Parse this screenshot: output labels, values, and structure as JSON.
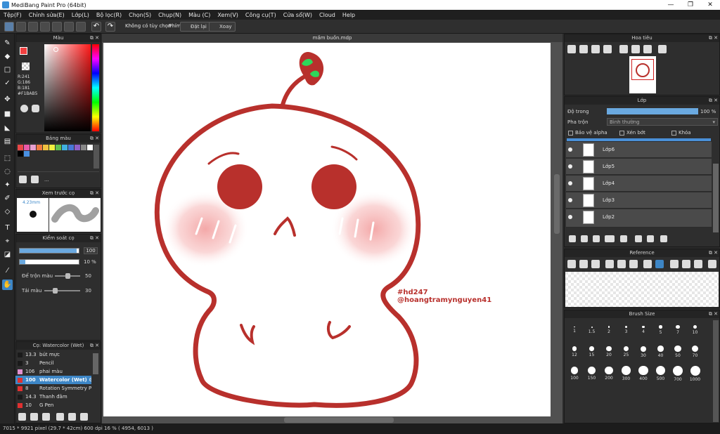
{
  "window": {
    "title": "MediBang Paint Pro (64bit)"
  },
  "menu": [
    "Tệp(F)",
    "Chỉnh sửa(E)",
    "Lớp(L)",
    "Bộ lọc(R)",
    "Chọn(S)",
    "Chụp(N)",
    "Màu (C)",
    "Xem(V)",
    "Công cụ(T)",
    "Cửa sổ(W)",
    "Cloud",
    "Help"
  ],
  "toolbar": {
    "no_option": "Không có tùy chọn",
    "phim": "Phím",
    "reset": "Đặt lại",
    "rotate": "Xoay"
  },
  "color_panel": {
    "title": "Màu",
    "r": "R:241",
    "g": "G:186",
    "b": "B:181",
    "hex": "#F1BAB5",
    "fg_color": "#F14040",
    "bg_color": "#FFFFFF"
  },
  "palette_panel": {
    "title": "Bảng màu",
    "more": "...",
    "swatches": [
      "#e84848",
      "#e85aa8",
      "#e8a0d0",
      "#f07a40",
      "#f0c040",
      "#f0f040",
      "#60c050",
      "#40b0e0",
      "#4878d8",
      "#9060c8",
      "#888888",
      "#ffffff",
      "#000000",
      "#4a90e2"
    ]
  },
  "preview_panel": {
    "title": "Xem trước cọ",
    "size": "4.23mm"
  },
  "brush_control": {
    "title": "Kiểm soát cọ",
    "size_value": "100",
    "opacity_value": "10 %",
    "size_pct": 0.97,
    "opacity_pct": 0.1,
    "blend_label": "Để trộn màu",
    "blend_value": "50",
    "blend_pct": 0.5,
    "refill_label": "Tải màu",
    "refill_value": "30",
    "refill_pct": 0.3
  },
  "brush_list": {
    "title": "Cọ: Watercolor (Wet)",
    "items": [
      {
        "size": "13.3",
        "name": "bút mực",
        "color": "#1a1a1a"
      },
      {
        "size": "3",
        "name": "Pencil",
        "color": "#1a1a1a"
      },
      {
        "size": "106",
        "name": "phai màu",
        "color": "#e090d0"
      },
      {
        "size": "100",
        "name": "Watercolor (Wet)",
        "color": "#e03030",
        "selected": true
      },
      {
        "size": "8",
        "name": "Rotation Symmetry Pe",
        "color": "#e03030"
      },
      {
        "size": "14.3",
        "name": "Thanh đâm",
        "color": "#1a1a1a"
      },
      {
        "size": "10",
        "name": "G Pen",
        "color": "#e03030"
      }
    ]
  },
  "document": {
    "tab": "mầm buồn.mdp",
    "tag1": "#hd247",
    "tag2": "@hoangtramynguyen41"
  },
  "navigator": {
    "title": "Hoa tiêu"
  },
  "layers": {
    "title": "Lớp",
    "opacity_label": "Độ trong",
    "opacity_value": "100 %",
    "opacity_pct": 1.0,
    "blend_label": "Pha trộn",
    "blend_value": "Bình thường",
    "protect_alpha": "Bảo vệ alpha",
    "clipping": "Xén bớt",
    "lock": "Khóa",
    "items": [
      "Lớp6",
      "Lớp5",
      "Lớp4",
      "Lớp3",
      "Lớp2"
    ]
  },
  "reference": {
    "title": "Reference"
  },
  "brush_size": {
    "title": "Brush Size",
    "sizes": [
      "1",
      "1.5",
      "2",
      "3",
      "4",
      "5",
      "7",
      "10",
      "12",
      "15",
      "20",
      "25",
      "30",
      "40",
      "50",
      "70",
      "100",
      "150",
      "200",
      "300",
      "400",
      "500",
      "700",
      "1000"
    ]
  },
  "status": {
    "text": "7015 * 9921 pixel    (29.7 * 42cm)   600 dpi   16 %   ( 4954, 6013 )"
  }
}
